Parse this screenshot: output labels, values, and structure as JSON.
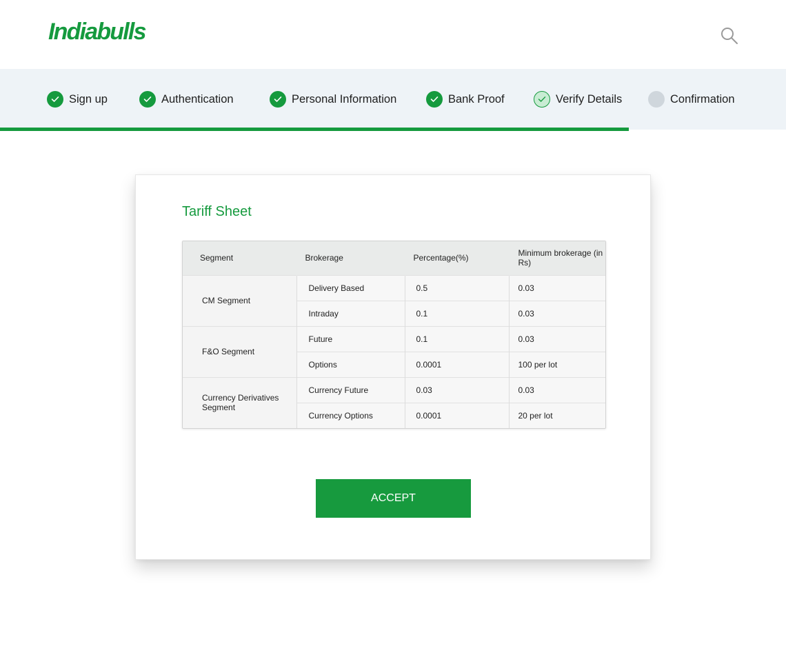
{
  "brand": {
    "logo_text": "Indiabulls",
    "accent_color": "#159a3e"
  },
  "header": {
    "search_icon": "search-icon"
  },
  "stepper": {
    "steps": [
      {
        "label": "Sign up",
        "state": "done"
      },
      {
        "label": "Authentication",
        "state": "done"
      },
      {
        "label": "Personal Information",
        "state": "done"
      },
      {
        "label": "Bank Proof",
        "state": "done"
      },
      {
        "label": "Verify Details",
        "state": "current"
      },
      {
        "label": "Confirmation",
        "state": "todo"
      }
    ],
    "progress_fraction": 0.8
  },
  "card": {
    "title": "Tariff Sheet",
    "table": {
      "headers": [
        "Segment",
        "Brokerage",
        "Percentage(%)",
        "Minimum brokerage (in Rs)"
      ],
      "groups": [
        {
          "segment": "CM Segment",
          "rows": [
            {
              "brokerage": "Delivery Based",
              "percentage": "0.5",
              "minimum": "0.03"
            },
            {
              "brokerage": "Intraday",
              "percentage": "0.1",
              "minimum": "0.03"
            }
          ]
        },
        {
          "segment": "F&O Segment",
          "rows": [
            {
              "brokerage": "Future",
              "percentage": "0.1",
              "minimum": "0.03"
            },
            {
              "brokerage": "Options",
              "percentage": "0.0001",
              "minimum": "100 per lot"
            }
          ]
        },
        {
          "segment": "Currency Derivatives Segment",
          "rows": [
            {
              "brokerage": "Currency Future",
              "percentage": "0.03",
              "minimum": "0.03"
            },
            {
              "brokerage": "Currency Options",
              "percentage": "0.0001",
              "minimum": "20 per lot"
            }
          ]
        }
      ]
    },
    "accept_label": "ACCEPT"
  }
}
